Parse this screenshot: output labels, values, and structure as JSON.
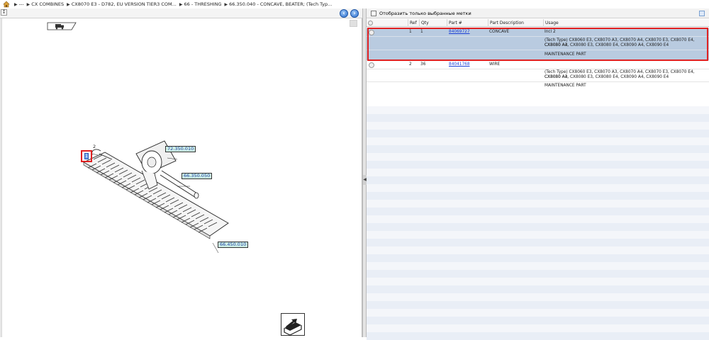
{
  "breadcrumb": {
    "items": [
      "---",
      "CX COMBINES",
      "CX8070 E3 - D782, EU VERSION TIER3 COM...",
      "66 - THRESHING",
      "66.350.040 - CONCAVE, BEATER; (Tech Typ..."
    ]
  },
  "diagram": {
    "callouts": [
      "72.350.010",
      "66.350.050",
      "66.450.010"
    ],
    "ref_label": "2",
    "ref_highlight": "1"
  },
  "filter": {
    "label": "Отобразить только выбранные метки"
  },
  "table": {
    "columns": [
      "Ref",
      "Qty",
      "Part #",
      "Part Description",
      "Usage"
    ],
    "rows": [
      {
        "ref": "1",
        "qty": "1",
        "part": "84069727",
        "description": "CONCAVE",
        "usage": [
          "Incl 2",
          "(Tech Type) CX8060 E3, CX8070 A3, CX8070 A4, CX8070 E3, CX8070 E4, CX8080 A3,",
          "CX8080 A4, CX8080 E3, CX8080 E4, CX8090 A4, CX8090 E4",
          "MAINTENANCE PART"
        ],
        "selected": true
      },
      {
        "ref": "2",
        "qty": "36",
        "part": "84041768",
        "description": "WIRE",
        "usage": [
          "",
          "(Tech Type) CX8060 E3, CX8070 A3, CX8070 A4, CX8070 E3, CX8070 E4, CX8080 A3,",
          "CX8080 A4, CX8080 E3, CX8080 E4, CX8090 A4, CX8090 E4",
          "MAINTENANCE PART"
        ],
        "selected": false
      }
    ]
  },
  "colors": {
    "selected_row": "#b9cbe0",
    "highlight_border": "#e02020",
    "callout_fill": "#cdeee4",
    "stripe": "#e9eef6",
    "link": "#1a3fd6"
  },
  "icons": {
    "home": "home-icon",
    "back": "back-arrow-icon",
    "forward": "forward-arrow-icon",
    "truck": "truck-icon",
    "export": "export-icon"
  }
}
